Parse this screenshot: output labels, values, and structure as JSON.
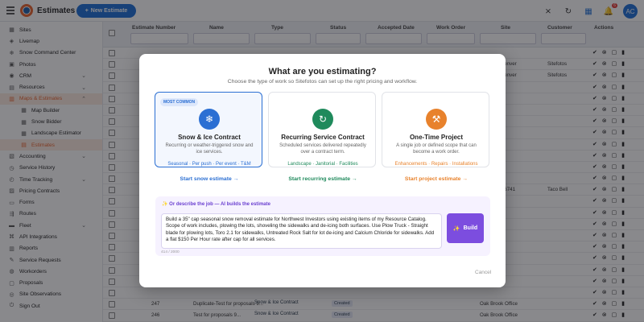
{
  "app": {
    "title": "Estimates",
    "new_button": "New Estimate",
    "notification_count": "6",
    "avatar_initials": "AC"
  },
  "sidebar": {
    "items": [
      {
        "label": "Sites",
        "icon": "building-icon"
      },
      {
        "label": "Livemap",
        "icon": "map-icon"
      },
      {
        "label": "Snow Command Center",
        "icon": "snowflake-icon"
      },
      {
        "label": "Photos",
        "icon": "photo-icon"
      },
      {
        "label": "CRM",
        "icon": "crm-icon"
      },
      {
        "label": "Resources",
        "icon": "resources-icon"
      },
      {
        "label": "Maps & Estimates",
        "icon": "maps-icon"
      },
      {
        "label": "Map Builder",
        "icon": "grid-icon"
      },
      {
        "label": "Snow Bidder",
        "icon": "grid-icon"
      },
      {
        "label": "Landscape Estimator",
        "icon": "grid-icon"
      },
      {
        "label": "Estimates",
        "icon": "estimate-icon"
      },
      {
        "label": "Accounting",
        "icon": "accounting-icon"
      },
      {
        "label": "Service History",
        "icon": "history-icon"
      },
      {
        "label": "Time Tracking",
        "icon": "clock-icon"
      },
      {
        "label": "Pricing Contracts",
        "icon": "contract-icon"
      },
      {
        "label": "Forms",
        "icon": "form-icon"
      },
      {
        "label": "Routes",
        "icon": "route-icon"
      },
      {
        "label": "Fleet",
        "icon": "truck-icon"
      },
      {
        "label": "API Integrations",
        "icon": "api-icon"
      },
      {
        "label": "Reports",
        "icon": "report-icon"
      },
      {
        "label": "Service Requests",
        "icon": "request-icon"
      },
      {
        "label": "Workorders",
        "icon": "workorder-icon"
      },
      {
        "label": "Proposals",
        "icon": "proposal-icon"
      },
      {
        "label": "Site Observations",
        "icon": "observation-icon"
      },
      {
        "label": "Sign Out",
        "icon": "signout-icon"
      }
    ]
  },
  "table": {
    "headers": [
      "Estimate Number",
      "Name",
      "Type",
      "Status",
      "Accepted Date",
      "Work Order",
      "Site",
      "Customer",
      "Actions"
    ],
    "rows": [
      {
        "number": "",
        "name": "",
        "type": "",
        "status": "",
        "site": "",
        "customer": ""
      },
      {
        "number": "",
        "name": "",
        "type": "",
        "status": "",
        "site": "Sitefotos Denver",
        "customer": "Sitefotos"
      },
      {
        "number": "",
        "name": "",
        "type": "",
        "status": "",
        "site": "Sitefotos Denver",
        "customer": "Sitefotos"
      },
      {
        "number": "",
        "name": "",
        "type": "",
        "status": "",
        "site": "",
        "customer": ""
      },
      {
        "number": "",
        "name": "",
        "type": "",
        "status": "",
        "site": "",
        "customer": ""
      },
      {
        "number": "",
        "name": "",
        "type": "",
        "status": "",
        "site": "",
        "customer": ""
      },
      {
        "number": "",
        "name": "",
        "type": "",
        "status": "",
        "site": "",
        "customer": ""
      },
      {
        "number": "",
        "name": "",
        "type": "",
        "status": "",
        "site": "",
        "customer": ""
      },
      {
        "number": "",
        "name": "",
        "type": "",
        "status": "",
        "site": "",
        "customer": ""
      },
      {
        "number": "",
        "name": "",
        "type": "",
        "status": "",
        "site": "",
        "customer": ""
      },
      {
        "number": "",
        "name": "",
        "type": "",
        "status": "",
        "site": "",
        "customer": ""
      },
      {
        "number": "",
        "name": "",
        "type": "",
        "status": "",
        "site": "",
        "customer": ""
      },
      {
        "number": "",
        "name": "",
        "type": "",
        "status": "",
        "site": "Taco Bell 26741",
        "customer": "Taco Bell"
      },
      {
        "number": "",
        "name": "",
        "type": "",
        "status": "",
        "site": "",
        "customer": ""
      },
      {
        "number": "",
        "name": "",
        "type": "",
        "status": "",
        "site": "",
        "customer": ""
      },
      {
        "number": "",
        "name": "",
        "type": "",
        "status": "",
        "site": "",
        "customer": ""
      },
      {
        "number": "",
        "name": "",
        "type": "",
        "status": "",
        "site": "",
        "customer": ""
      },
      {
        "number": "",
        "name": "",
        "type": "",
        "status": "",
        "site": "",
        "customer": ""
      },
      {
        "number": "",
        "name": "",
        "type": "",
        "status": "",
        "site": "",
        "customer": ""
      },
      {
        "number": "",
        "name": "",
        "type": "",
        "status": "",
        "site": "",
        "customer": ""
      },
      {
        "number": "",
        "name": "",
        "type": "",
        "status": "",
        "site": "",
        "customer": ""
      },
      {
        "number": "",
        "name": "",
        "type": "",
        "status": "",
        "site": "",
        "customer": ""
      },
      {
        "number": "247",
        "name": "Duplicate-Test for proposals 9...",
        "type": "Snow & Ice Contract",
        "status": "Created",
        "site": "Oak Brook Office",
        "customer": ""
      },
      {
        "number": "246",
        "name": "Test for proposals 9...",
        "type": "Snow & Ice Contract",
        "status": "Created",
        "site": "Oak Brook Office",
        "customer": ""
      }
    ]
  },
  "modal": {
    "title": "What are you estimating?",
    "subtitle": "Choose the type of work so Sitefotos can set up the right pricing and workflow.",
    "cards": [
      {
        "badge": "MOST COMMON",
        "title": "Snow & Ice Contract",
        "description": "Recurring or weather-triggered snow and ice services.",
        "tags": "Seasonal · Per push · Per event · T&M",
        "cta": "Start snow estimate →",
        "color": "#2b6fd3",
        "icon": "snowflake-icon"
      },
      {
        "badge": "",
        "title": "Recurring Service Contract",
        "description": "Scheduled services delivered repeatedly over a contract term.",
        "tags": "Landscape · Janitorial · Facilities",
        "cta": "Start recurring estimate →",
        "color": "#1f8a5c",
        "icon": "refresh-icon"
      },
      {
        "badge": "",
        "title": "One-Time Project",
        "description": "A single job or defined scope that can become a work order.",
        "tags": "Enhancements · Repairs · Installations",
        "cta": "Start project estimate →",
        "color": "#e8822c",
        "icon": "wrench-icon"
      }
    ],
    "ai": {
      "label": "Or describe the job — AI builds the estimate",
      "text": "Build a 35\" cap seasonal snow removal estimate for Northwest Investors using existing items of my Resource Catalog. Scope of work includes, plowing the lots, shoveling the sidewalks and de-icing both surfaces. Use Plow Truck - Straight blade for plowing lots, Toro 2.1 for sidewalks, Untreated Rock Salt for lot de-icing and Calcium Chloride for sidewalks. Add a flat $150 Per Hour rate after cap for all services.",
      "count": "414 / 2000",
      "build_label": "Build"
    },
    "cancel_label": "Cancel"
  }
}
